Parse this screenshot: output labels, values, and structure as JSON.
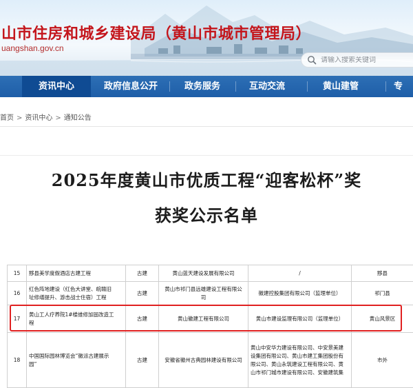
{
  "header": {
    "site_title": "山市住房和城乡建设局（黄山市城市管理局）",
    "site_domain": "uangshan.gov.cn",
    "search_placeholder": "请输入搜索关键词"
  },
  "nav": {
    "items": [
      {
        "label": "资讯中心",
        "active": true
      },
      {
        "label": "政府信息公开",
        "active": false
      },
      {
        "label": "政务服务",
        "active": false
      },
      {
        "label": "互动交流",
        "active": false
      },
      {
        "label": "黄山建管",
        "active": false
      },
      {
        "label": "专",
        "active": false
      }
    ]
  },
  "breadcrumb": {
    "items": [
      "首页",
      "资讯中心",
      "通知公告"
    ],
    "separator": ">"
  },
  "headline": {
    "line1": "2025年度黄山市优质工程“迎客松杯”奖",
    "line2": "获奖公示名单"
  },
  "table": {
    "rows": [
      {
        "no": "15",
        "project": [
          "黟县美学度假酒店古建工程"
        ],
        "category": "古建",
        "builder": [
          "黄山蓝天建设发展有限公司"
        ],
        "partners": [
          "/"
        ],
        "region": "黟县"
      },
      {
        "no": "16",
        "project": [
          "红色阵地建设（红色大讲堂、皖赣旧",
          "址修缮提升、游击战士住宿）工程"
        ],
        "category": "古建",
        "builder": [
          "黄山市祁门县远雄建设工程有限公",
          "司"
        ],
        "partners": [
          "徽建控股集团有限公司（监理单位）"
        ],
        "region": "祁门县"
      },
      {
        "no": "17",
        "project": [
          "黄山工人疗养院1#楼维修加固改造工",
          "程"
        ],
        "category": "古建",
        "builder": [
          "黄山徽建工程有限公司"
        ],
        "partners": [
          "黄山市建设监理有限公司（监理单位）"
        ],
        "region": "黄山风景区"
      },
      {
        "no": "18",
        "project": [
          "中国国际园林博览会“徽派古建展示",
          "园”"
        ],
        "category": "古建",
        "builder": [
          "安徽省徽州古典园林建设有限公司"
        ],
        "partners": [
          "黄山中安华力建设有限公司、中安景美建",
          "设集团有限公司、黄山市建工集团股份有",
          "限公司、黄山永筑建设工程有限公司、黄",
          "山市祁门城市建设有限公司、安徽建筑集"
        ],
        "region": "市外"
      }
    ]
  },
  "colors": {
    "title_red": "#c4161c",
    "nav_blue": "#1e5ea8",
    "nav_active": "#0f4b93",
    "highlight_red": "#e02020"
  },
  "icons": {
    "search": "search-icon"
  }
}
